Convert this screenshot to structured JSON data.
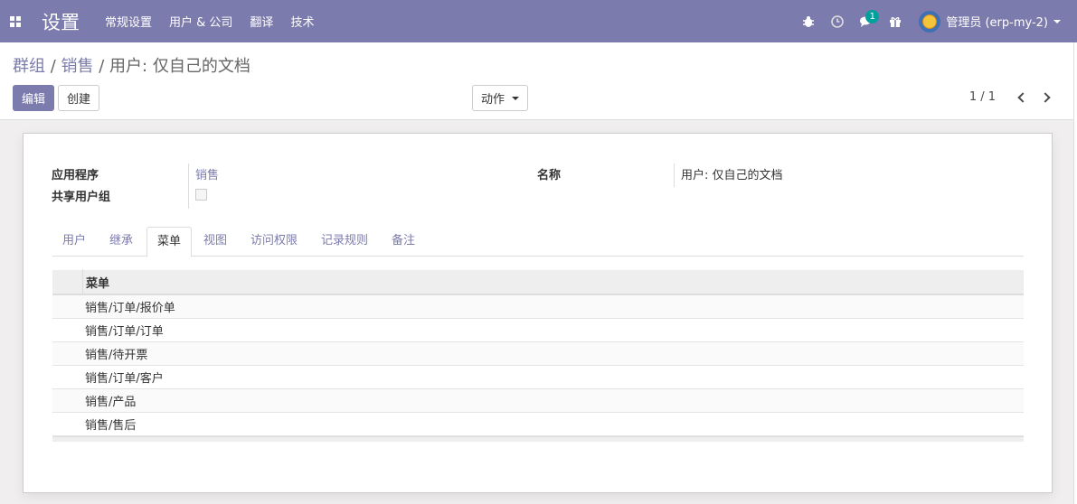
{
  "navbar": {
    "app_title": "设置",
    "menu": [
      "常规设置",
      "用户 & 公司",
      "翻译",
      "技术"
    ],
    "icons": [
      "bug-icon",
      "clock-icon",
      "chat-icon",
      "gift-icon"
    ],
    "message_count": "1",
    "user_name": "管理员 (erp-my-2)"
  },
  "control_panel": {
    "breadcrumb_groups": "群组",
    "breadcrumb_sep1": " / ",
    "breadcrumb_sales": "销售",
    "breadcrumb_sep2": " / ",
    "breadcrumb_current": "用户: 仅自己的文档",
    "edit_label": "编辑",
    "create_label": "创建",
    "action_label": "动作",
    "pager": "1 / 1"
  },
  "form": {
    "application_label": "应用程序",
    "application_value": "销售",
    "shared_label": "共享用户组",
    "name_label": "名称",
    "name_value": "用户: 仅自己的文档"
  },
  "tabs": [
    "用户",
    "继承",
    "菜单",
    "视图",
    "访问权限",
    "记录规则",
    "备注"
  ],
  "active_tab": "菜单",
  "menu_table": {
    "header": "菜单",
    "rows": [
      "销售/订单/报价单",
      "销售/订单/订单",
      "销售/待开票",
      "销售/订单/客户",
      "销售/产品",
      "销售/售后"
    ]
  },
  "colors": {
    "brand": "#7c7bad",
    "badge": "#00a09d"
  }
}
